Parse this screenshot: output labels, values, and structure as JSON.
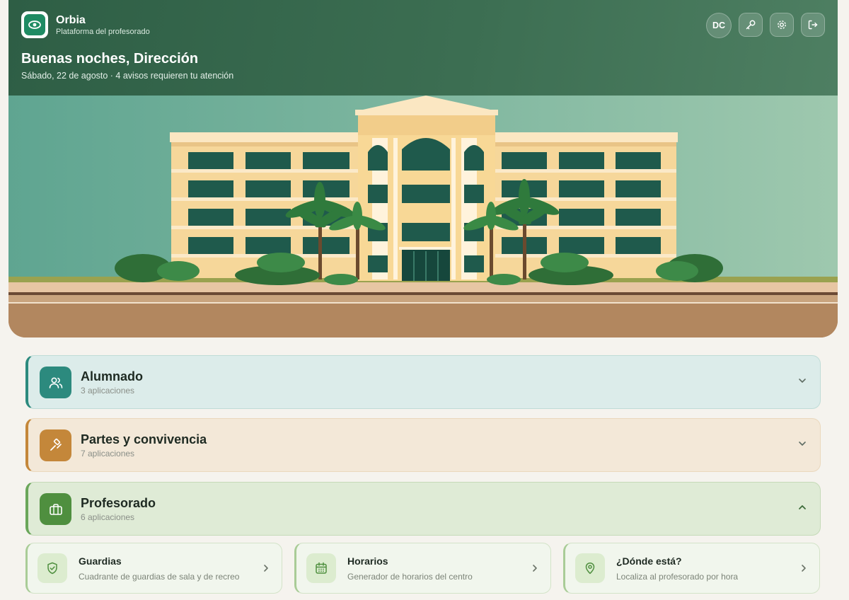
{
  "header": {
    "app_name": "Orbia",
    "app_subtitle": "Plataforma del profesorado",
    "greeting": "Buenas noches, Dirección",
    "date_line": "Sábado, 22 de agosto · 4 avisos requieren tu atención",
    "user_initials": "DC",
    "actions": [
      "key-icon",
      "gear-icon",
      "logout-icon"
    ]
  },
  "categories": [
    {
      "title": "Alumnado",
      "count": "3 aplicaciones",
      "icon": "users-icon",
      "accent": "#2c8a7e",
      "expanded": false
    },
    {
      "title": "Partes y convivencia",
      "count": "7 aplicaciones",
      "icon": "gavel-icon",
      "accent": "#c4873a",
      "expanded": false
    },
    {
      "title": "Profesorado",
      "count": "6 aplicaciones",
      "icon": "briefcase-icon",
      "accent": "#4f8f3f",
      "expanded": true
    }
  ],
  "apps": [
    {
      "title": "Guardias",
      "desc": "Cuadrante de guardias de sala y de recreo",
      "icon": "shield-check-icon"
    },
    {
      "title": "Horarios",
      "desc": "Generador de horarios del centro",
      "icon": "calendar-icon"
    },
    {
      "title": "¿Dónde está?",
      "desc": "Localiza al profesorado por hora",
      "icon": "map-pin-icon"
    }
  ],
  "colors": {
    "header_green": "#2e5e45",
    "brand": "#1f8b63"
  }
}
